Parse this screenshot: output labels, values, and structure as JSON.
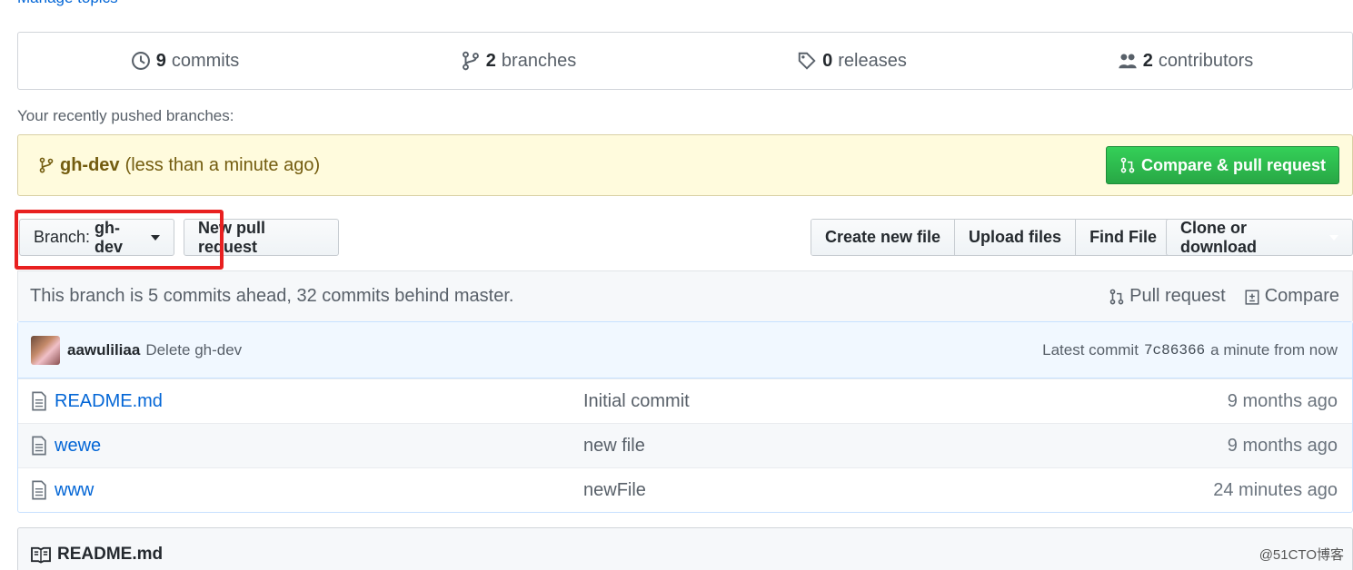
{
  "manage_topics": "Manage topics",
  "stats": {
    "commits": {
      "num": "9",
      "label": "commits"
    },
    "branches": {
      "num": "2",
      "label": "branches"
    },
    "releases": {
      "num": "0",
      "label": "releases"
    },
    "contributors": {
      "num": "2",
      "label": "contributors"
    }
  },
  "recent": {
    "label": "Your recently pushed branches:",
    "branch": "gh-dev",
    "time": "(less than a minute ago)",
    "compare_button": "Compare & pull request"
  },
  "toolbar": {
    "branch_prefix": "Branch:",
    "branch_name": "gh-dev",
    "new_pr": "New pull request",
    "create_file": "Create new file",
    "upload_files": "Upload files",
    "find_file": "Find File",
    "clone": "Clone or download"
  },
  "branch_info": {
    "text": "This branch is 5 commits ahead, 32 commits behind master.",
    "pull_request": "Pull request",
    "compare": "Compare"
  },
  "commit": {
    "author": "aawuliliaa",
    "message": "Delete gh-dev",
    "latest_prefix": "Latest commit",
    "sha": "7c86366",
    "time": "a minute from now"
  },
  "files": [
    {
      "name": "README.md",
      "message": "Initial commit",
      "age": "9 months ago"
    },
    {
      "name": "wewe",
      "message": "new file",
      "age": "9 months ago"
    },
    {
      "name": "www",
      "message": "newFile",
      "age": "24 minutes ago"
    }
  ],
  "readme": {
    "title": "README.md"
  },
  "watermark": "@51CTO博客",
  "colors": {
    "accent": "#0366d6",
    "green": "#28a745",
    "highlight": "#e82020"
  }
}
